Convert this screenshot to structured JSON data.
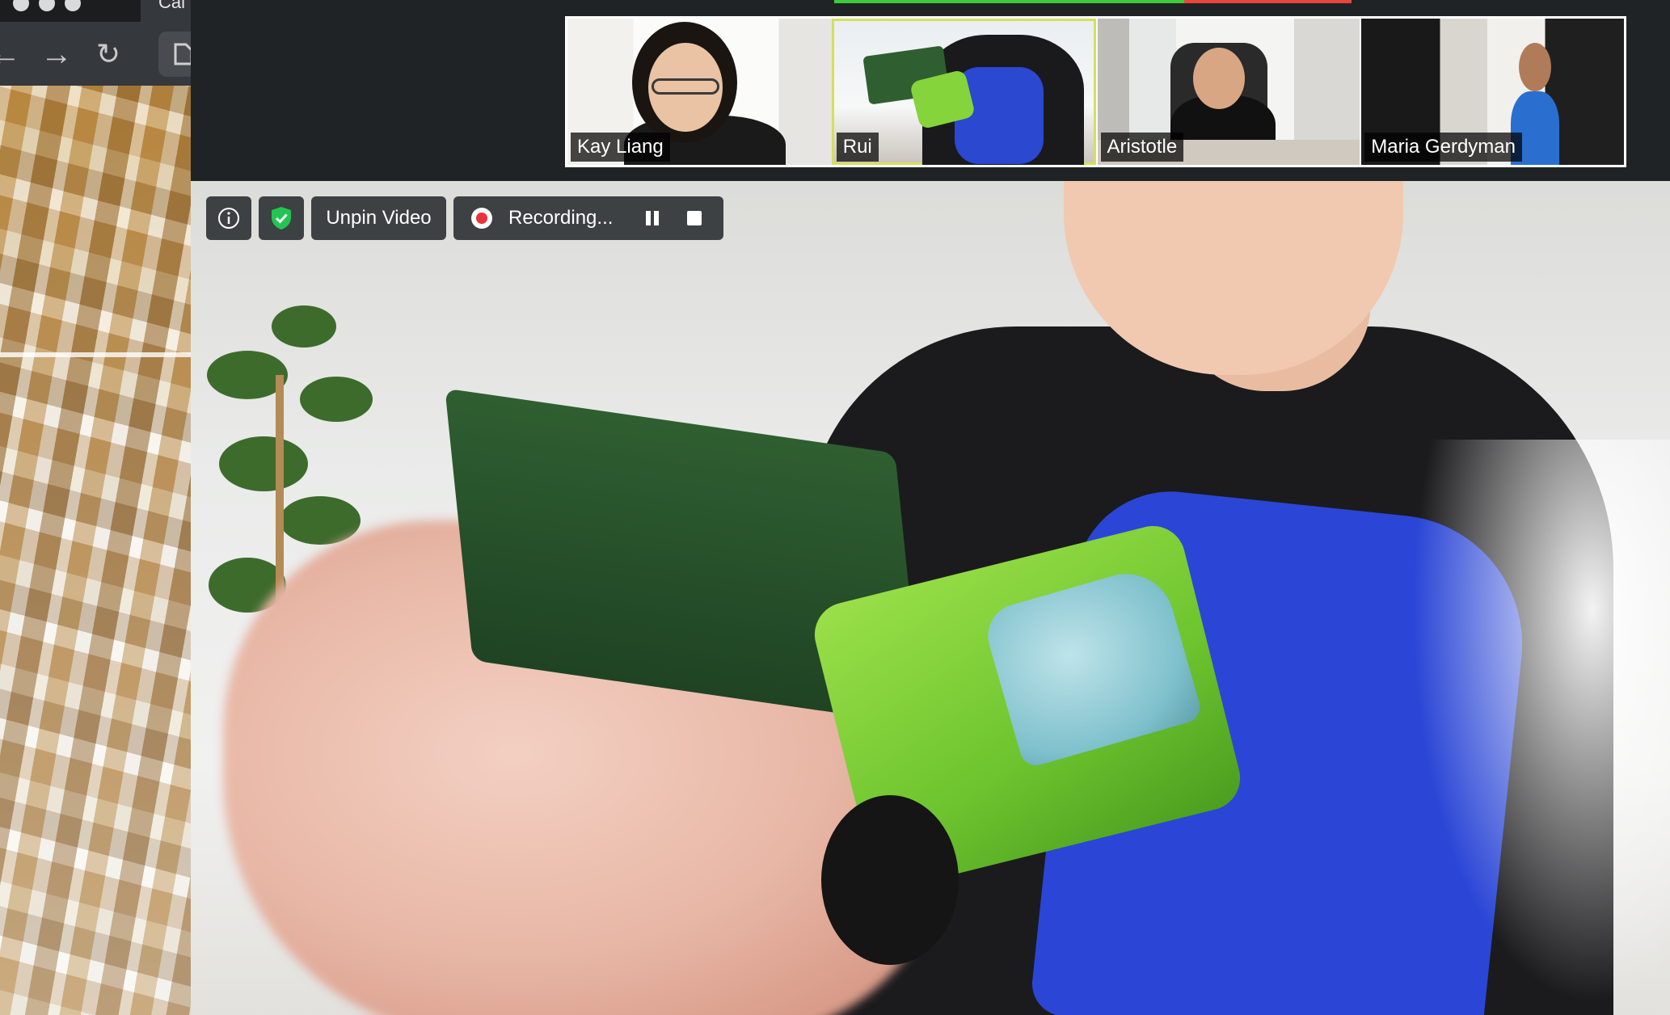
{
  "browser": {
    "tab_title": "Cal",
    "icons": {
      "back": "back-arrow-icon",
      "forward": "forward-arrow-icon",
      "reload": "reload-icon",
      "page": "page-icon"
    }
  },
  "meeting": {
    "participants": [
      {
        "name": "Kay Liang",
        "active": false
      },
      {
        "name": "Rui",
        "active": true
      },
      {
        "name": "Aristotle",
        "active": false
      },
      {
        "name": "Maria Gerdyman",
        "active": false
      }
    ],
    "controls": {
      "info_icon": "info-icon",
      "security_icon": "shield-check-icon",
      "unpin_label": "Unpin Video",
      "recording_label": "Recording...",
      "pause_icon": "pause-icon",
      "stop_icon": "stop-icon"
    },
    "colors": {
      "active_speaker_outline": "#d4e05c",
      "speaking_green": "#3ecb3a",
      "speaking_red": "#e8453c",
      "security_green": "#23c552",
      "record_red": "#e8333a"
    }
  }
}
